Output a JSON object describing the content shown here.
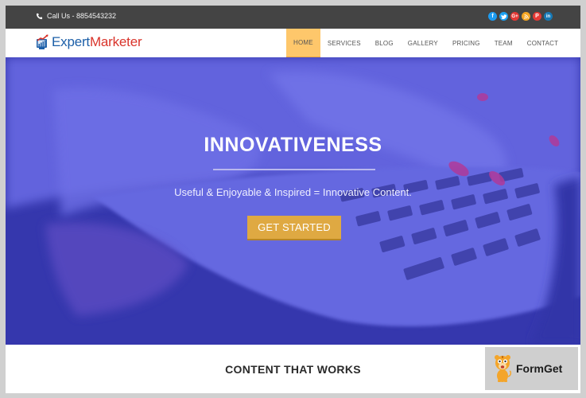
{
  "topbar": {
    "call_label": "Call Us - 8854543232",
    "social": [
      {
        "name": "facebook",
        "glyph": "f",
        "color": "#1d9bf0"
      },
      {
        "name": "twitter",
        "glyph": "t",
        "color": "#1da1f2"
      },
      {
        "name": "google-plus",
        "glyph": "G+",
        "color": "#e53935"
      },
      {
        "name": "rss",
        "glyph": "◔",
        "color": "#f5a623"
      },
      {
        "name": "pinterest",
        "glyph": "P",
        "color": "#e53935"
      },
      {
        "name": "linkedin",
        "glyph": "in",
        "color": "#1779b5"
      }
    ]
  },
  "navbar": {
    "logo_part1": "Expert",
    "logo_part2": "Marketer",
    "items": [
      {
        "label": "HOME",
        "active": true
      },
      {
        "label": "SERVICES",
        "active": false
      },
      {
        "label": "BLOG",
        "active": false
      },
      {
        "label": "GALLERY",
        "active": false
      },
      {
        "label": "PRICING",
        "active": false
      },
      {
        "label": "TEAM",
        "active": false
      },
      {
        "label": "CONTACT",
        "active": false
      }
    ]
  },
  "hero": {
    "title": "INNOVATIVENESS",
    "subtitle": "Useful & Enjoyable & Inspired = Innovative Content.",
    "button_label": "GET STARTED"
  },
  "section": {
    "title": "CONTENT THAT WORKS"
  },
  "watermark": {
    "label": "FormGet"
  },
  "colors": {
    "topbar": "#444444",
    "nav_active": "#fec76b",
    "hero_overlay": "#3a3cb4",
    "button": "#dfa942",
    "logo_blue": "#1c5fa8",
    "logo_red": "#d9342b"
  }
}
